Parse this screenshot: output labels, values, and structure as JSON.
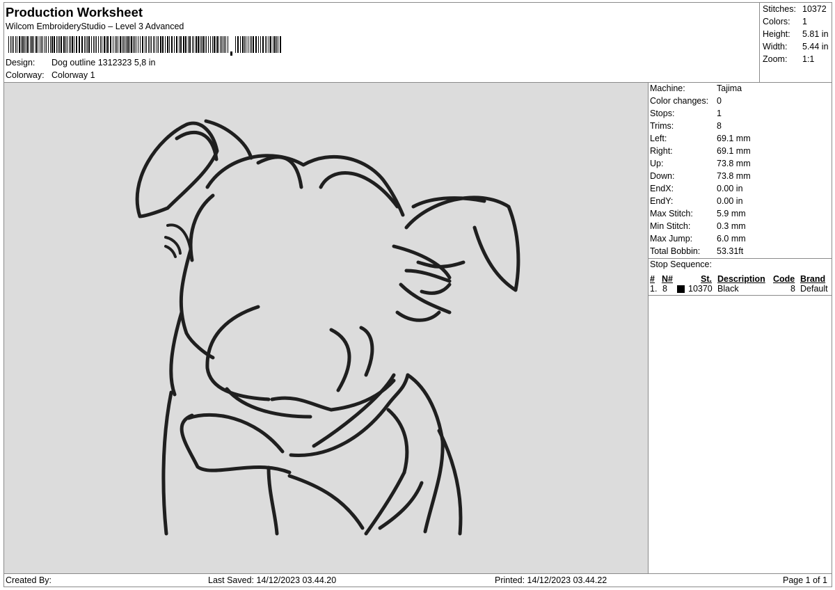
{
  "header": {
    "title": "Production Worksheet",
    "software": "Wilcom EmbroideryStudio – Level 3 Advanced",
    "design_label": "Design:",
    "design_value": "Dog outline 1312323 5,8 in",
    "colorway_label": "Colorway:",
    "colorway_value": "Colorway 1"
  },
  "summary": [
    {
      "label": "Stitches:",
      "value": "10372"
    },
    {
      "label": "Colors:",
      "value": "1"
    },
    {
      "label": "Height:",
      "value": "5.81 in"
    },
    {
      "label": "Width:",
      "value": "5.44 in"
    },
    {
      "label": "Zoom:",
      "value": "1:1"
    }
  ],
  "machine_info": [
    {
      "label": "Machine:",
      "value": "Tajima"
    },
    {
      "label": "Color changes:",
      "value": "0"
    },
    {
      "label": "Stops:",
      "value": "1"
    },
    {
      "label": "Trims:",
      "value": "8"
    },
    {
      "label": "Left:",
      "value": "69.1 mm"
    },
    {
      "label": "Right:",
      "value": "69.1 mm"
    },
    {
      "label": "Up:",
      "value": "73.8 mm"
    },
    {
      "label": "Down:",
      "value": "73.8 mm"
    },
    {
      "label": "EndX:",
      "value": "0.00 in"
    },
    {
      "label": "EndY:",
      "value": "0.00 in"
    },
    {
      "label": "Max Stitch:",
      "value": "5.9 mm"
    },
    {
      "label": "Min Stitch:",
      "value": "0.3 mm"
    },
    {
      "label": "Max Jump:",
      "value": "6.0 mm"
    },
    {
      "label": "Total Bobbin:",
      "value": "53.31ft"
    }
  ],
  "stop_sequence": {
    "title": "Stop Sequence:",
    "columns": [
      "#",
      "N#",
      "St.",
      "Description",
      "Code",
      "Brand"
    ],
    "rows": [
      {
        "num": "1.",
        "n": "8",
        "color": "#000000",
        "stitches": "10370",
        "description": "Black",
        "code": "8",
        "brand": "Default"
      }
    ]
  },
  "design_preview": {
    "thread_color": "#1f1f1f",
    "background": "#dcdcdc",
    "subject": "dog-outline"
  },
  "footer": {
    "created_by": "Created By:",
    "last_saved": "Last Saved: 14/12/2023 03.44.20",
    "printed": "Printed: 14/12/2023 03.44.22",
    "page": "Page 1 of 1"
  }
}
